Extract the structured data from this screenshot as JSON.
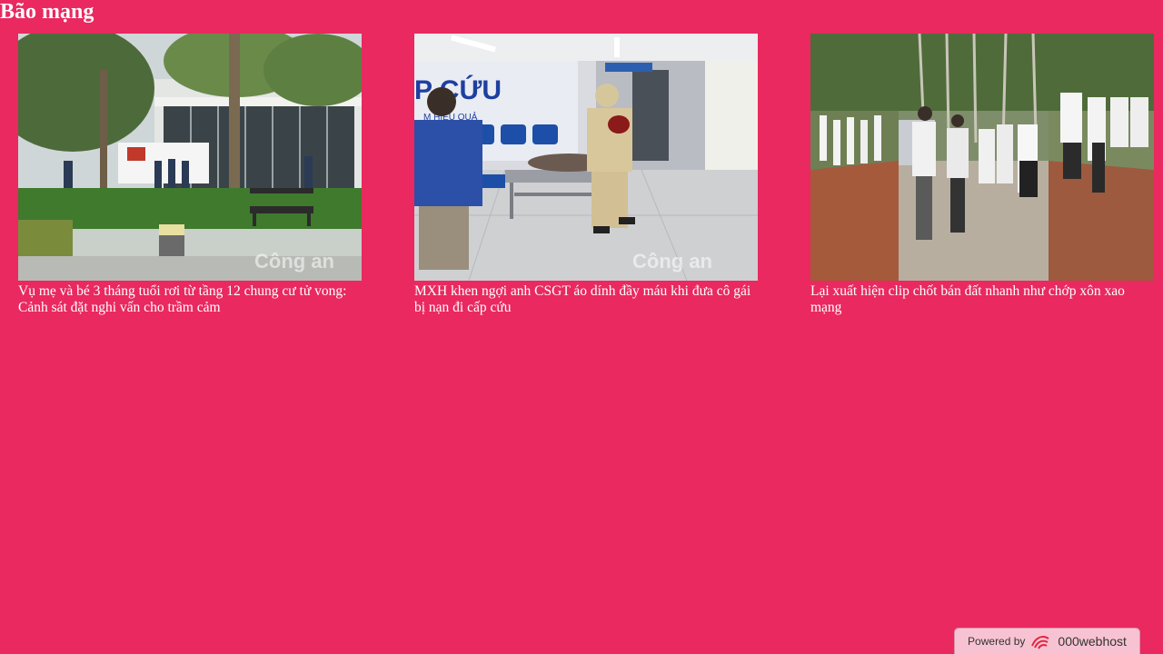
{
  "page": {
    "title": "Bão mạng"
  },
  "articles": [
    {
      "caption": "Vụ mẹ và bé 3 tháng tuổi rơi từ tầng 12 chung cư tử vong: Cảnh sát đặt nghi vấn cho trầm cảm",
      "image_alt": "scene outside apartment building with ambulance and police",
      "watermark": "Công an"
    },
    {
      "caption": "MXH khen ngợi anh CSGT áo dính đầy máu khi đưa cô gái bị nạn đi cấp cứu",
      "image_alt": "traffic police officer with injured girl on hospital stretcher",
      "watermark": "Công an",
      "sign_text": "P CỨU",
      "sign_subtext": "M HIỆU QUẢ"
    },
    {
      "caption": "Lại xuất hiện clip chốt bán đất nhanh như chớp xôn xao mạng",
      "image_alt": "crowd of people standing on dirt road near forest"
    }
  ],
  "footer_badge": {
    "powered_by": "Powered by",
    "brand": "000webhost"
  },
  "colors": {
    "background": "#e9295f",
    "text": "#ffffff"
  }
}
